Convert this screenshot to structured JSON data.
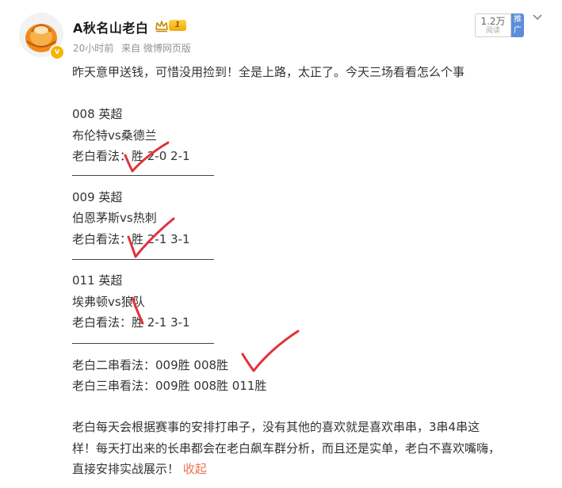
{
  "header": {
    "username": "A秋名山老白",
    "level": "1",
    "time": "20小时前",
    "source": "来自 微博网页版",
    "views": "1.2万",
    "views_label": "阅读",
    "promote": "推广"
  },
  "post": {
    "intro": "昨天意甲送钱，可惜没用捡到！全是上路，太正了。今天三场看看怎么个事",
    "matches": [
      {
        "code": "008 英超",
        "teams": "布伦特vs桑德兰",
        "pick": "老白看法：胜 2-0 2-1"
      },
      {
        "code": "009 英超",
        "teams": "伯恩茅斯vs热刺",
        "pick": "老白看法：胜 2-1 3-1"
      },
      {
        "code": "011 英超",
        "teams": "埃弗顿vs狼队",
        "pick": "老白看法：胜 2-1 3-1"
      }
    ],
    "parlay2": "老白二串看法：009胜 008胜",
    "parlay3": "老白三串看法：009胜 008胜 011胜",
    "outro_1": "老白每天会根据赛事的安排打串子，没有其他的喜欢就是喜欢串串，3串4串这",
    "outro_2": "样！每天打出来的长串都会在老白飙车群分析，而且还是实单，老白不喜欢嘴嗨，",
    "outro_3": "直接安排实战展示！",
    "collapse": "收起"
  },
  "colors": {
    "accent": "#eb7350",
    "check_marks": "#e0323a",
    "promote": "#5b8ed6",
    "level_badge": "#f2a900"
  },
  "icons": [
    "avatar",
    "verified-v-icon",
    "crown-icon",
    "chevron-down-icon",
    "check-mark-icon"
  ]
}
